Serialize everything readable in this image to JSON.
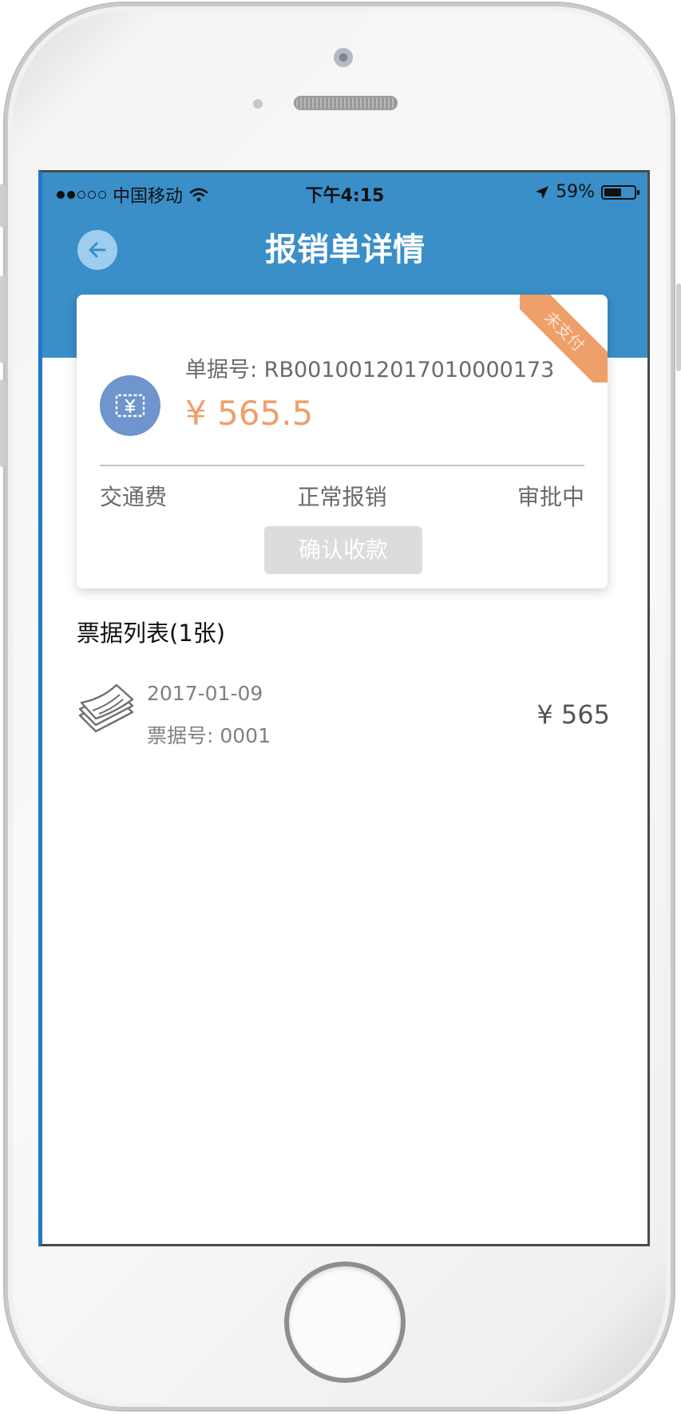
{
  "status_bar": {
    "carrier": "中国移动",
    "time": "下午4:15",
    "battery": "59%",
    "battery_fraction": 0.59,
    "signal_dots_filled": 2,
    "signal_dots_total": 5
  },
  "nav": {
    "title": "报销单详情",
    "back_icon": "back-arrow-icon"
  },
  "card": {
    "ribbon": "未支付",
    "doc_no": "单据号: RB0010012017010000173",
    "amount": "¥ 565.5",
    "category": "交通费",
    "type": "正常报销",
    "status": "审批中",
    "confirm_button": "确认收款"
  },
  "list": {
    "title": "票据列表(1张)",
    "items": [
      {
        "date": "2017-01-09",
        "invoice_no": "票据号: 0001",
        "amount": "¥ 565"
      }
    ]
  },
  "colors": {
    "header_blue": "#3a8fc8",
    "ribbon_orange": "#ef9f6a",
    "receipt_circle": "#6e95cd",
    "back_button": "#9fcdee"
  }
}
